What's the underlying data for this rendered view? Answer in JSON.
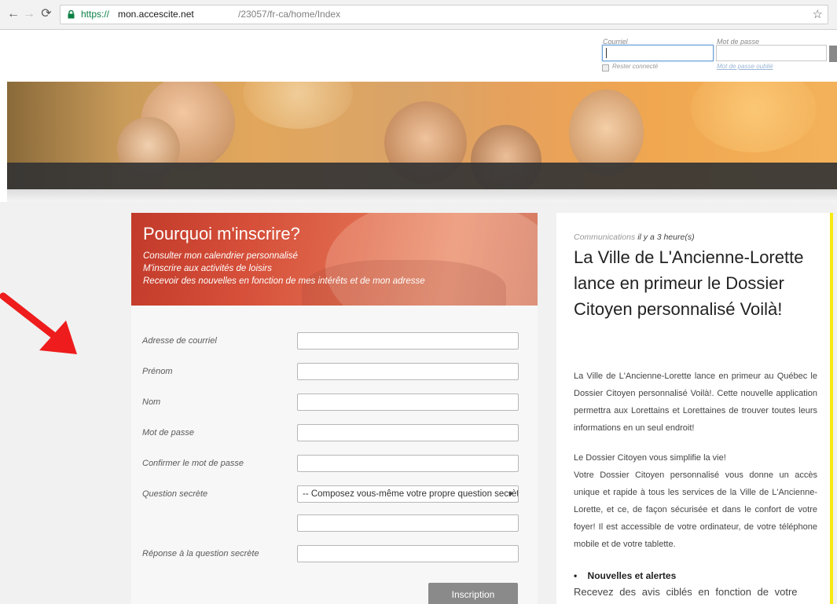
{
  "browser": {
    "back_icon": "arrow-left-icon",
    "forward_icon": "arrow-right-icon",
    "reload_icon": "reload-icon",
    "url_scheme": "https://",
    "url_host": "mon.accescite.net",
    "url_path": "/23057/fr-ca/home/Index",
    "bookmark_icon": "star-icon"
  },
  "login": {
    "email_label": "Courriel",
    "password_label": "Mot de passe",
    "remember_label": "Rester connecté",
    "forgot_link": "Mot de passe oublié"
  },
  "registration": {
    "title": "Pourquoi m'inscrire?",
    "benefits": [
      "Consulter mon calendrier personnalisé",
      "M'inscrire aux activités de loisirs",
      "Recevoir des nouvelles en fonction de mes intérêts et de mon adresse"
    ],
    "fields": {
      "email": "Adresse de courriel",
      "firstname": "Prénom",
      "lastname": "Nom",
      "password": "Mot de passe",
      "confirm": "Confirmer le mot de passe",
      "question": "Question secrète",
      "answer": "Réponse à la question secrète"
    },
    "question_select_value": "-- Composez vous-même votre propre question secrète --",
    "submit_label": "Inscription"
  },
  "article": {
    "category": "Communications",
    "time_ago": "il y a 3 heure(s)",
    "title": "La Ville de L'Ancienne-Lorette lance en primeur le Dossier Citoyen personnalisé Voilà!",
    "paragraph1": "La Ville de L'Ancienne-Lorette lance en primeur au Québec le Dossier Citoyen personnalisé Voilà!. Cette nouvelle application permettra aux Lorettains et Lorettaines de trouver toutes leurs informations en un seul endroit!",
    "paragraph2_heading": "Le Dossier Citoyen vous simplifie la vie!",
    "paragraph2": "Votre Dossier Citoyen personnalisé vous donne un accès unique et rapide à tous les services de la Ville de L'Ancienne-Lorette, et ce, de façon sécurisée et dans le confort de votre foyer! Il est accessible de votre ordinateur, de votre téléphone mobile et de votre tablette.",
    "bullet_title": "Nouvelles et alertes",
    "bullet_text": "Recevez des avis ciblés en fonction de votre"
  },
  "colors": {
    "accent_red": "#d6503a",
    "article_border": "#f7ea12",
    "button_gray": "#8a8a8a"
  }
}
